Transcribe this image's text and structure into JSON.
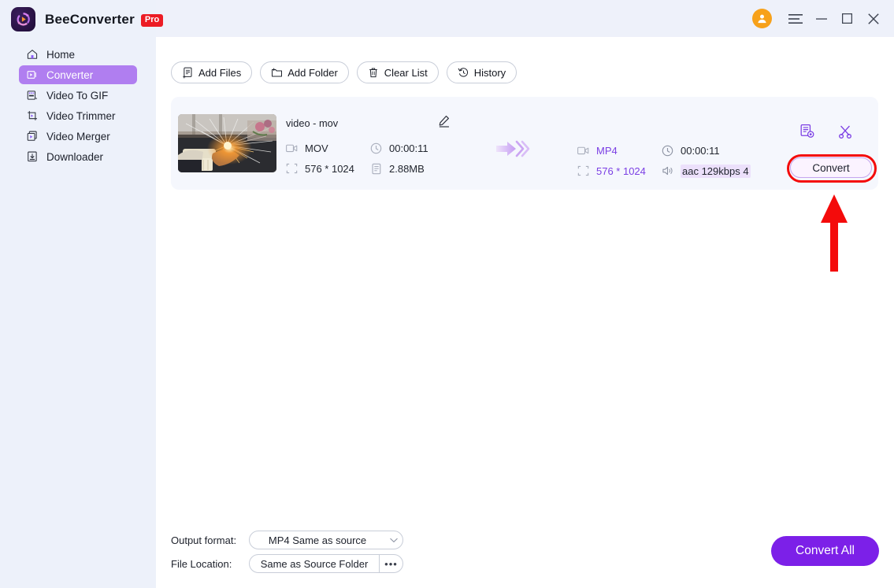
{
  "window": {
    "app_title": "BeeConverter",
    "pro_badge": "Pro",
    "logo_icon": "beeconverter-logo-icon",
    "avatar_icon": "user-avatar-icon",
    "menu_icon": "hamburger-menu-icon",
    "minimize_icon": "minimize-icon",
    "maximize_icon": "maximize-icon",
    "close_icon": "close-icon"
  },
  "sidebar": {
    "items": [
      {
        "label": "Home",
        "icon": "home-icon",
        "active": false
      },
      {
        "label": "Converter",
        "icon": "converter-icon",
        "active": true
      },
      {
        "label": "Video To GIF",
        "icon": "video-to-gif-icon",
        "active": false
      },
      {
        "label": "Video Trimmer",
        "icon": "video-trimmer-icon",
        "active": false
      },
      {
        "label": "Video Merger",
        "icon": "video-merger-icon",
        "active": false
      },
      {
        "label": "Downloader",
        "icon": "downloader-icon",
        "active": false
      }
    ]
  },
  "toolbar": {
    "buttons": [
      {
        "label": "Add Files",
        "icon": "add-files-icon"
      },
      {
        "label": "Add Folder",
        "icon": "add-folder-icon"
      },
      {
        "label": "Clear List",
        "icon": "trash-icon"
      },
      {
        "label": "History",
        "icon": "history-icon"
      }
    ]
  },
  "file_card": {
    "name": "video - mov",
    "edit_icon": "edit-pencil-icon",
    "thumbnail_icon": "video-thumbnail",
    "source": {
      "format": "MOV",
      "format_icon": "video-format-icon",
      "duration": "00:00:11",
      "duration_icon": "clock-icon",
      "resolution": "576 * 1024",
      "resolution_icon": "resolution-icon",
      "size": "2.88MB",
      "size_icon": "file-size-icon"
    },
    "arrow_icon": "convert-arrow-icon",
    "output": {
      "format": "MP4",
      "format_icon": "video-format-icon",
      "duration": "00:00:11",
      "duration_icon": "clock-icon",
      "resolution": "576 * 1024",
      "resolution_icon": "resolution-icon",
      "audio": "aac 129kbps 4",
      "audio_icon": "audio-icon"
    },
    "settings_icon": "output-settings-icon",
    "cut_icon": "scissors-icon",
    "convert_label": "Convert"
  },
  "annotation": {
    "highlight_color": "#f40b0b",
    "arrow_icon": "red-up-arrow-annotation",
    "target": "Convert"
  },
  "bottom": {
    "output_format_label": "Output format:",
    "output_format_value": "MP4 Same as source",
    "output_format_caret_icon": "chevron-down-icon",
    "file_location_label": "File Location:",
    "file_location_value": "Same as Source Folder",
    "file_location_more_icon": "ellipsis-icon",
    "file_location_more": "•••",
    "convert_all_label": "Convert All"
  },
  "colors": {
    "accent": "#7c20e8",
    "sidebar_active": "#b07ef0",
    "sidebar_bg": "#edf1fa",
    "card_bg": "#f5f7fd",
    "pro_red": "#ec1c24",
    "avatar_orange": "#f7a11a",
    "annotation_red": "#f40b0b"
  }
}
